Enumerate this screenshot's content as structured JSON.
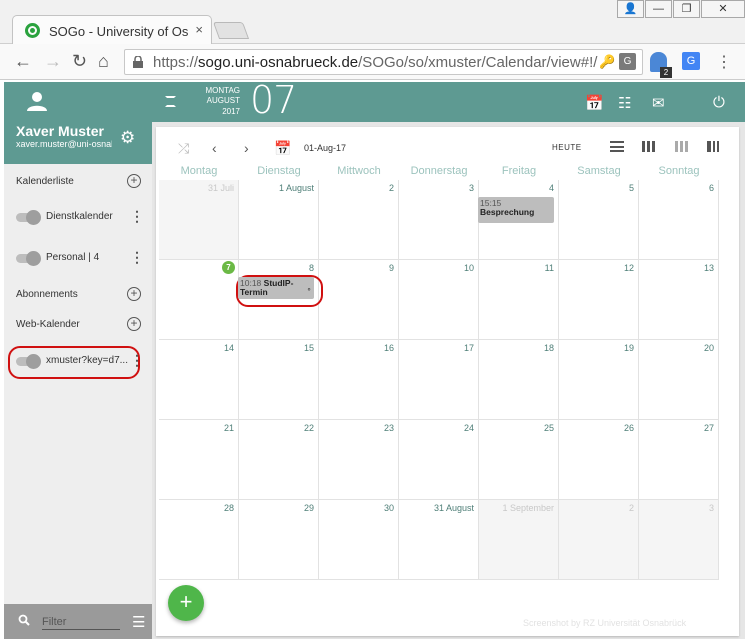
{
  "browser": {
    "tab_title": "SOGo - University of Osnabrück",
    "tab_close": "×",
    "window_user": "👤",
    "window_min": "—",
    "window_max": "❐",
    "window_close": "✕",
    "url_host": "sogo.uni-osnabrueck.de",
    "url_scheme": "https://",
    "url_path": "/SOGo/so/xmuster/Calendar/view#!/",
    "extension_badge": "2",
    "translate_label": "G"
  },
  "user": {
    "name": "Xaver Muster",
    "email": "xaver.muster@uni-osnabrueck.de"
  },
  "sidebar": {
    "sections": {
      "calendars": "Kalenderliste",
      "subscriptions": "Abonnements",
      "web_calendars": "Web-Kalender"
    },
    "calendars": [
      {
        "label": "Dienstkalender"
      },
      {
        "label": "Personal | 4"
      }
    ],
    "web_calendars": [
      {
        "label": "xmuster?key=d7..."
      }
    ],
    "filter_placeholder": "Filter"
  },
  "topbar": {
    "weekday": "MONTAG",
    "month": "AUGUST",
    "year": "2017",
    "day": "07"
  },
  "toolbar": {
    "date": "01-Aug-17",
    "today": "HEUTE"
  },
  "weekdays": [
    "Montag",
    "Dienstag",
    "Mittwoch",
    "Donnerstag",
    "Freitag",
    "Samstag",
    "Sonntag"
  ],
  "weeks": [
    [
      {
        "label": "31 Juli",
        "other": true
      },
      {
        "label": "1 August"
      },
      {
        "label": "2"
      },
      {
        "label": "3"
      },
      {
        "label": "4"
      },
      {
        "label": "5"
      },
      {
        "label": "6"
      }
    ],
    [
      {
        "label": "7",
        "today": true
      },
      {
        "label": "8"
      },
      {
        "label": "9"
      },
      {
        "label": "10"
      },
      {
        "label": "11"
      },
      {
        "label": "12"
      },
      {
        "label": "13"
      }
    ],
    [
      {
        "label": "14"
      },
      {
        "label": "15"
      },
      {
        "label": "16"
      },
      {
        "label": "17"
      },
      {
        "label": "18"
      },
      {
        "label": "19"
      },
      {
        "label": "20"
      }
    ],
    [
      {
        "label": "21"
      },
      {
        "label": "22"
      },
      {
        "label": "23"
      },
      {
        "label": "24"
      },
      {
        "label": "25"
      },
      {
        "label": "26"
      },
      {
        "label": "27"
      }
    ],
    [
      {
        "label": "28"
      },
      {
        "label": "29"
      },
      {
        "label": "30"
      },
      {
        "label": "31 August"
      },
      {
        "label": "1 September",
        "other": true
      },
      {
        "label": "2",
        "other": true
      },
      {
        "label": "3",
        "other": true
      }
    ]
  ],
  "events": [
    {
      "time": "15:15",
      "title": "Besprechung"
    },
    {
      "time": "10:18",
      "title": "StudIP-Termin"
    }
  ],
  "fab_label": "+",
  "credit": "Screenshot by RZ Universität Osnabrück",
  "colors": {
    "header_teal": "#5e9a92",
    "fab_green": "#4fb64a",
    "highlight_red": "#d01010",
    "event_grey": "#bdbdbd"
  }
}
